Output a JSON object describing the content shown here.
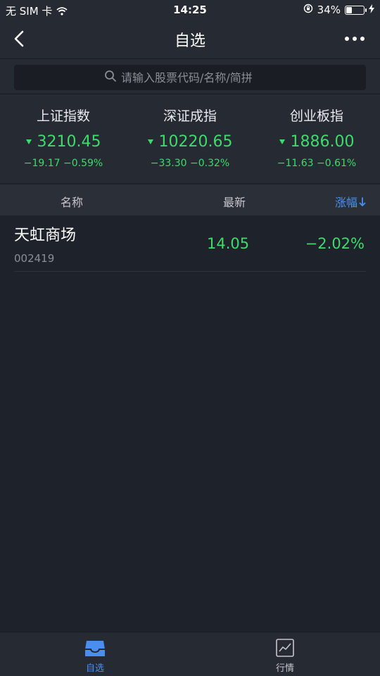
{
  "status_bar": {
    "carrier": "无 SIM 卡",
    "time": "14:25",
    "battery_percent": "34%",
    "battery_level": 0.34
  },
  "nav": {
    "title": "自选"
  },
  "search": {
    "placeholder": "请输入股票代码/名称/简拼"
  },
  "indices": [
    {
      "name": "上证指数",
      "value": "3210.45",
      "change": "−19.17  −0.59%"
    },
    {
      "name": "深证成指",
      "value": "10220.65",
      "change": "−33.30  −0.32%"
    },
    {
      "name": "创业板指",
      "value": "1886.00",
      "change": "−11.63  −0.61%"
    }
  ],
  "table": {
    "headers": {
      "name": "名称",
      "latest": "最新",
      "change": "涨幅"
    },
    "rows": [
      {
        "name": "天虹商场",
        "code": "002419",
        "price": "14.05",
        "change": "−2.02%"
      }
    ]
  },
  "tabs": [
    {
      "label": "自选",
      "active": true
    },
    {
      "label": "行情",
      "active": false
    }
  ],
  "colors": {
    "background": "#1e222b",
    "panel": "#262a33",
    "down_green": "#3ddc6a",
    "accent_blue": "#4a8ff0"
  }
}
